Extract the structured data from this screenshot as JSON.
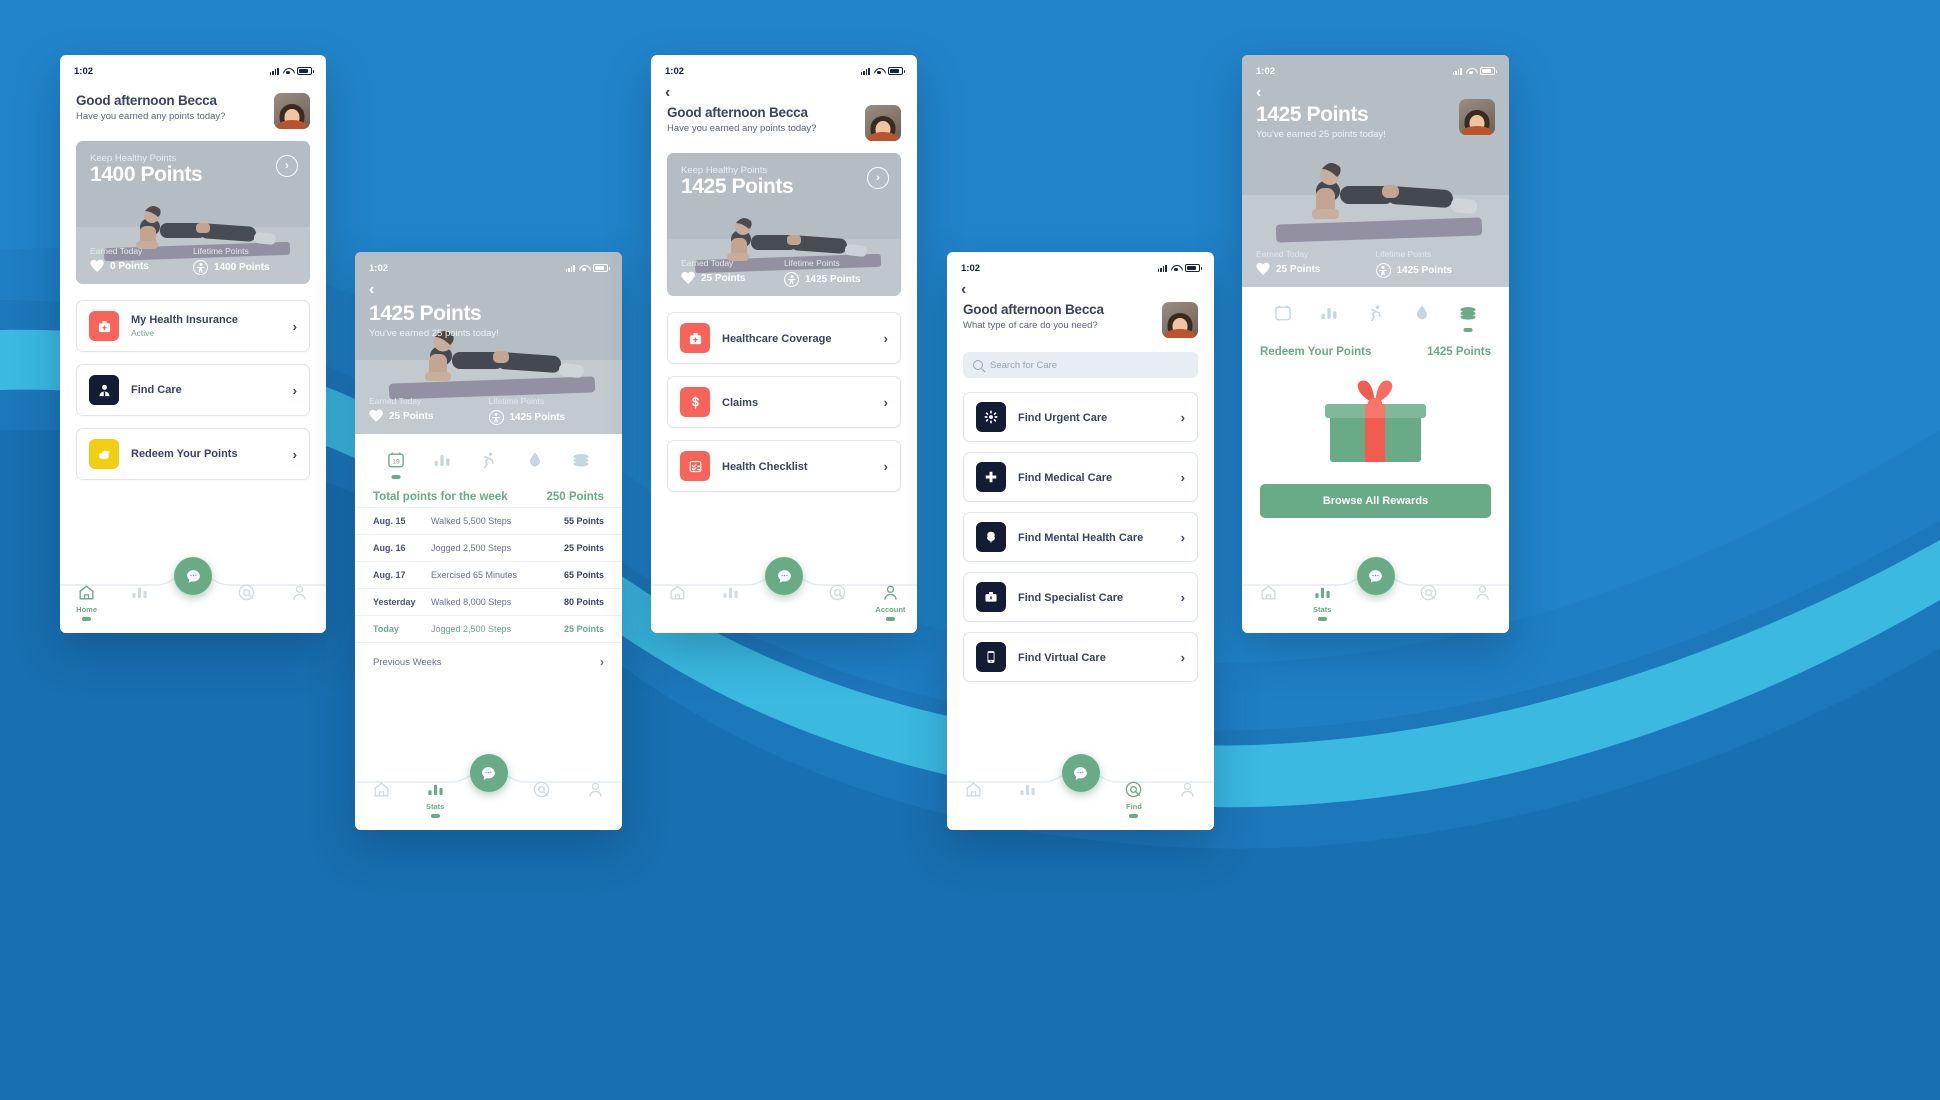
{
  "theme": {
    "background_blue": "#1f7ec4",
    "accent_green": "#6aab87",
    "text_dark": "#3a4360",
    "red": "#f8635a",
    "yellow": "#f2ce13",
    "navy": "#121c35"
  },
  "status_bar": {
    "time": "1:02"
  },
  "screens": {
    "home": {
      "greeting_title": "Good afternoon Becca",
      "greeting_subtitle": "Have you earned any points today?",
      "hero": {
        "label": "Keep Healthy Points",
        "points": "1400 Points",
        "arrow": "›",
        "earned_today_label": "Earned Today",
        "earned_today_value": "0 Points",
        "lifetime_label": "Lifetime Points",
        "lifetime_value": "1400 Points"
      },
      "cards": [
        {
          "title": "My Health Insurance",
          "status": "Active",
          "icon": "first-aid-kit-icon",
          "color": "#f8635a"
        },
        {
          "title": "Find Care",
          "status": "",
          "icon": "doctor-icon",
          "color": "#121c35"
        },
        {
          "title": "Redeem Your Points",
          "status": "",
          "icon": "coins-icon",
          "color": "#f2ce13"
        }
      ],
      "nav_active": "Home"
    },
    "stats": {
      "hero": {
        "points": "1425 Points",
        "subtitle": "You've earned 25 points today!",
        "earned_today_label": "Earned Today",
        "earned_today_value": "25 Points",
        "lifetime_label": "Lifetime Points",
        "lifetime_value": "1425 Points"
      },
      "tabs": [
        "calendar-icon",
        "bar-chart-icon",
        "running-icon",
        "water-drop-icon",
        "coins-stack-icon"
      ],
      "tab_active_index": 0,
      "total_label": "Total points for the week",
      "total_value": "250 Points",
      "rows": [
        {
          "date": "Aug. 15",
          "activity": "Walked 5,500 Steps",
          "points": "55 Points",
          "today": false
        },
        {
          "date": "Aug. 16",
          "activity": "Jogged 2,500 Steps",
          "points": "25 Points",
          "today": false
        },
        {
          "date": "Aug. 17",
          "activity": "Exercised 65 Minutes",
          "points": "65 Points",
          "today": false
        },
        {
          "date": "Yesterday",
          "activity": "Walked 8,000 Steps",
          "points": "80 Points",
          "today": false
        },
        {
          "date": "Today",
          "activity": "Jogged 2,500 Steps",
          "points": "25 Points",
          "today": true
        }
      ],
      "previous_weeks": "Previous Weeks",
      "nav_active": "Stats"
    },
    "insurance": {
      "greeting_title": "Good afternoon Becca",
      "greeting_subtitle": "Have you earned any points today?",
      "hero": {
        "label": "Keep Healthy Points",
        "points": "1425 Points",
        "arrow": "›",
        "earned_today_label": "Earned Today",
        "earned_today_value": "25 Points",
        "lifetime_label": "Lifetime Points",
        "lifetime_value": "1425 Points"
      },
      "cards": [
        {
          "title": "Healthcare Coverage",
          "icon": "first-aid-kit-icon",
          "color": "#f8635a"
        },
        {
          "title": "Claims",
          "icon": "dollar-icon",
          "color": "#f8635a"
        },
        {
          "title": "Health Checklist",
          "icon": "checklist-icon",
          "color": "#f8635a"
        }
      ],
      "nav_active": "Account"
    },
    "find_care": {
      "greeting_title": "Good afternoon Becca",
      "greeting_subtitle": "What type of care do you need?",
      "search_placeholder": "Search for Care",
      "search_value": "",
      "items": [
        {
          "title": "Find Urgent Care",
          "icon": "urgent-care-icon"
        },
        {
          "title": "Find Medical Care",
          "icon": "medical-cross-icon"
        },
        {
          "title": "Find Mental Health Care",
          "icon": "brain-icon"
        },
        {
          "title": "Find Specialist Care",
          "icon": "briefcase-icon"
        },
        {
          "title": "Find Virtual Care",
          "icon": "phone-icon"
        }
      ],
      "nav_active": "Find"
    },
    "rewards": {
      "hero": {
        "points": "1425 Points",
        "subtitle": "You've earned 25 points today!",
        "earned_today_label": "Earned Today",
        "earned_today_value": "25 Points",
        "lifetime_label": "Lifetime Points",
        "lifetime_value": "1425 Points"
      },
      "tabs": [
        "calendar-icon",
        "bar-chart-icon",
        "running-icon",
        "water-drop-icon",
        "coins-stack-icon"
      ],
      "tab_active_index": 4,
      "redeem_label": "Redeem Your Points",
      "redeem_points": "1425 Points",
      "browse_button": "Browse All Rewards",
      "nav_active": "Stats"
    }
  },
  "nav": {
    "items": [
      "Home",
      "Stats",
      "Chat",
      "Find",
      "Account"
    ],
    "icons": [
      "home-icon",
      "bar-chart-icon",
      "chat-bubble-icon",
      "target-icon",
      "person-icon"
    ]
  }
}
